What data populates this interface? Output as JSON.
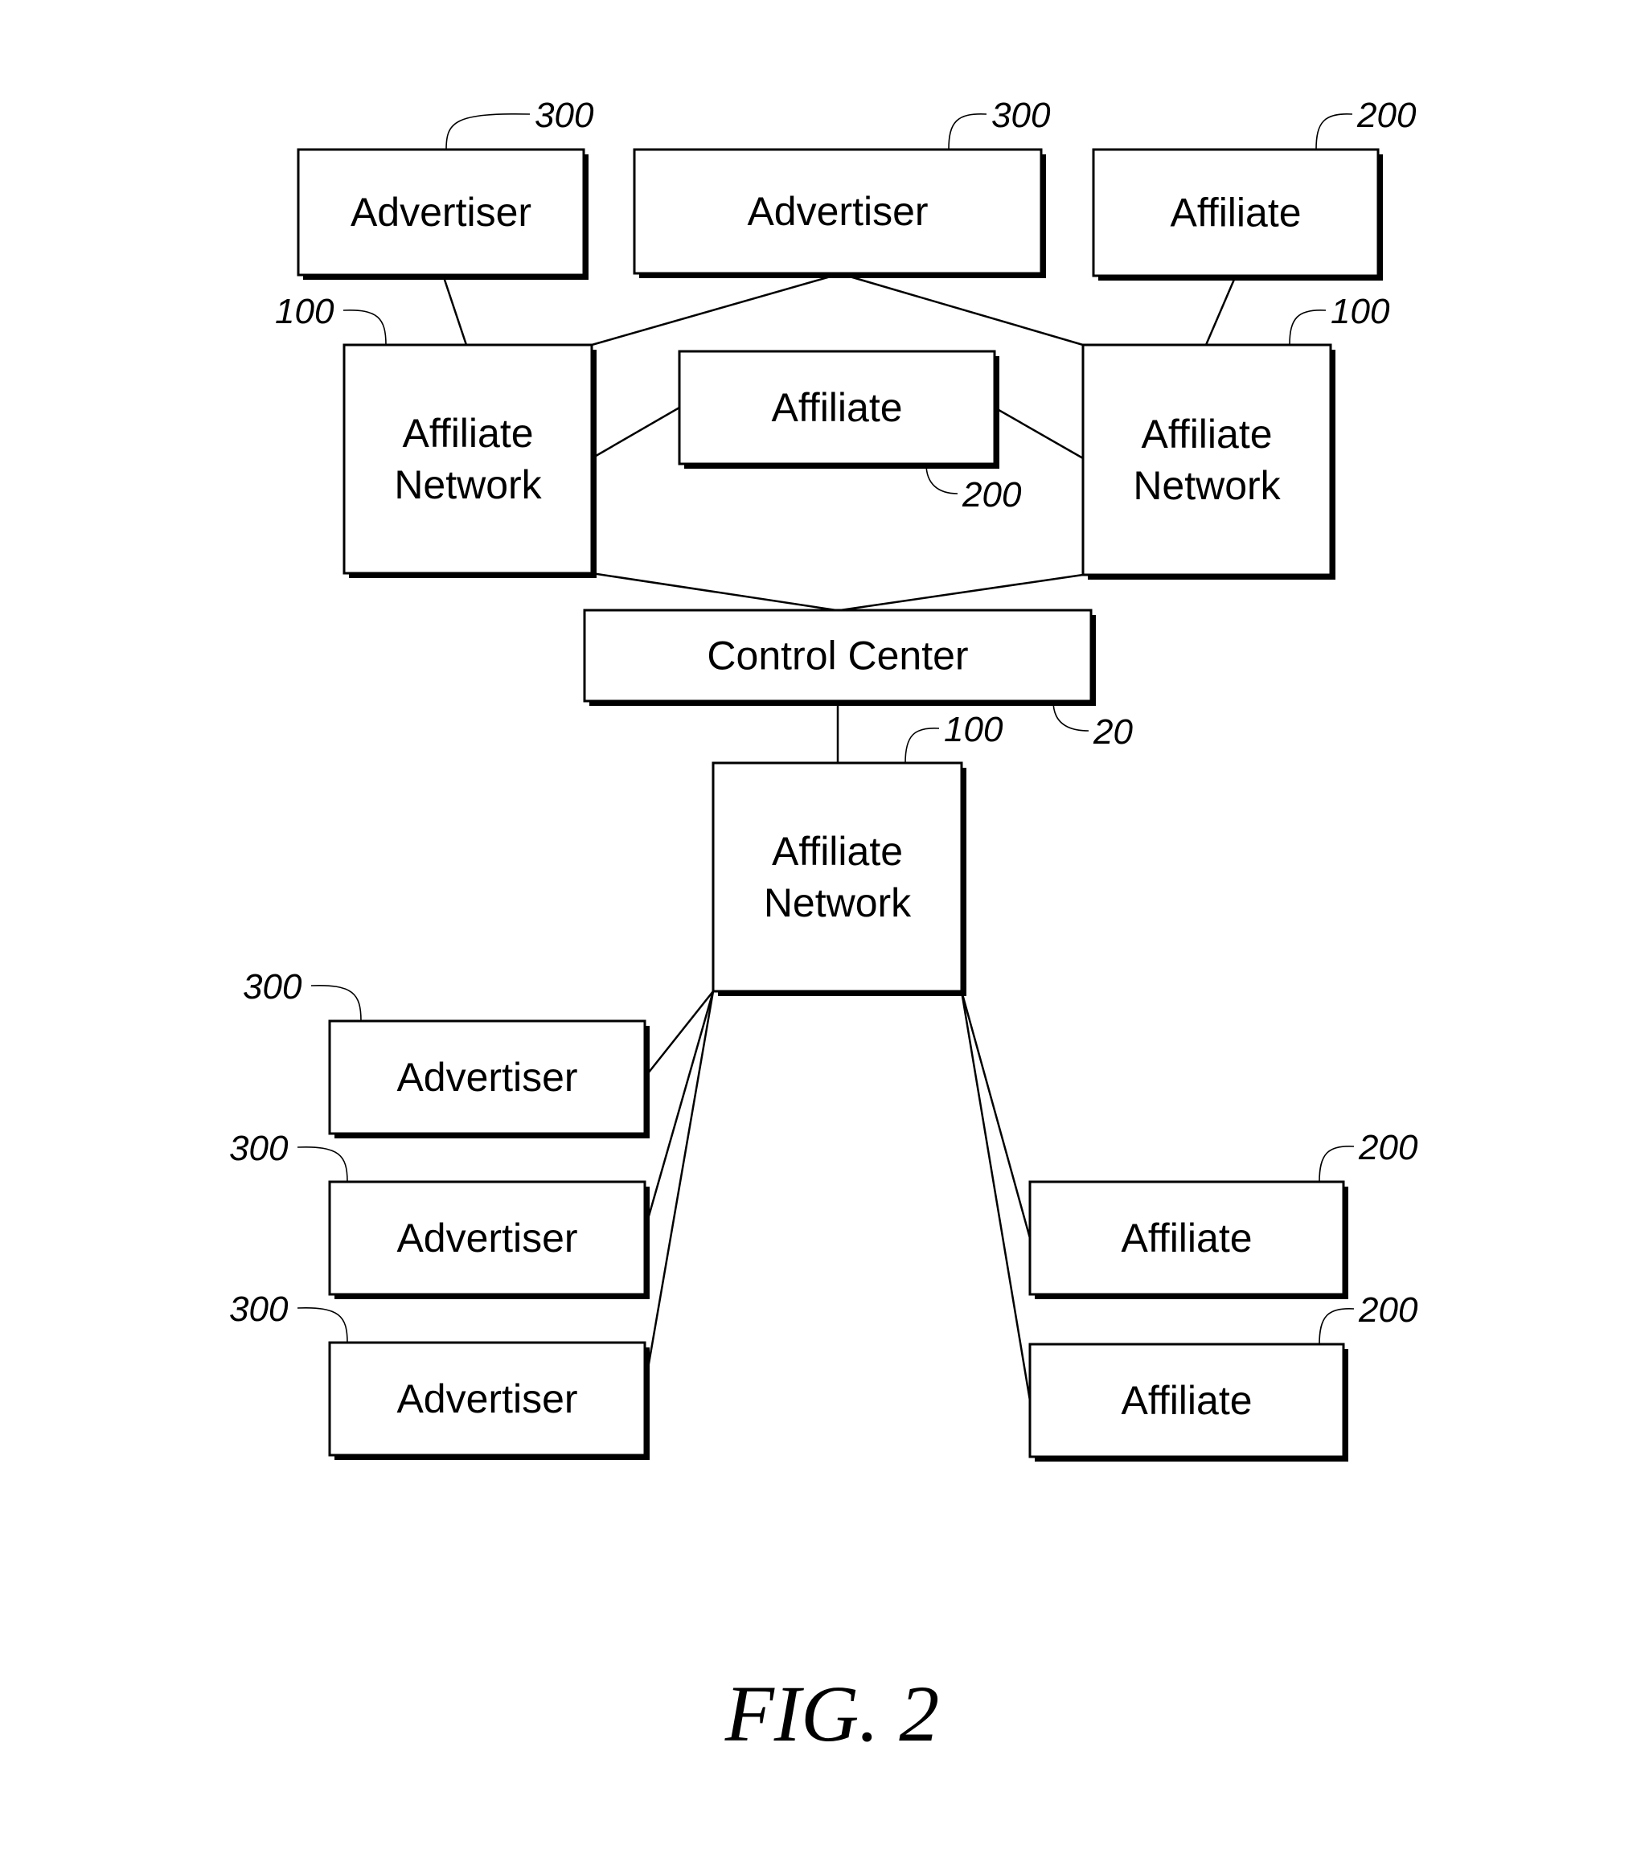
{
  "figure": {
    "caption": "FIG. 2"
  },
  "nodes": [
    {
      "id": "adv-top-left",
      "label": [
        "Advertiser"
      ],
      "ref": "300"
    },
    {
      "id": "adv-top-mid",
      "label": [
        "Advertiser"
      ],
      "ref": "300"
    },
    {
      "id": "aff-top-right",
      "label": [
        "Affiliate"
      ],
      "ref": "200"
    },
    {
      "id": "an-left",
      "label": [
        "Affiliate",
        "Network"
      ],
      "ref": "100"
    },
    {
      "id": "aff-mid",
      "label": [
        "Affiliate"
      ],
      "ref": "200"
    },
    {
      "id": "an-right",
      "label": [
        "Affiliate",
        "Network"
      ],
      "ref": "100"
    },
    {
      "id": "control-center",
      "label": [
        "Control Center"
      ],
      "ref": "20"
    },
    {
      "id": "an-bottom",
      "label": [
        "Affiliate",
        "Network"
      ],
      "ref": "100"
    },
    {
      "id": "adv-bottom-1",
      "label": [
        "Advertiser"
      ],
      "ref": "300"
    },
    {
      "id": "adv-bottom-2",
      "label": [
        "Advertiser"
      ],
      "ref": "300"
    },
    {
      "id": "adv-bottom-3",
      "label": [
        "Advertiser"
      ],
      "ref": "300"
    },
    {
      "id": "aff-bottom-1",
      "label": [
        "Affiliate"
      ],
      "ref": "200"
    },
    {
      "id": "aff-bottom-2",
      "label": [
        "Affiliate"
      ],
      "ref": "200"
    }
  ],
  "edges": [
    [
      "adv-top-left",
      "an-left"
    ],
    [
      "adv-top-mid",
      "an-left"
    ],
    [
      "adv-top-mid",
      "an-right"
    ],
    [
      "aff-top-right",
      "an-right"
    ],
    [
      "an-left",
      "aff-mid"
    ],
    [
      "aff-mid",
      "an-right"
    ],
    [
      "an-left",
      "control-center"
    ],
    [
      "an-right",
      "control-center"
    ],
    [
      "control-center",
      "an-bottom"
    ],
    [
      "an-bottom",
      "adv-bottom-1"
    ],
    [
      "an-bottom",
      "adv-bottom-2"
    ],
    [
      "an-bottom",
      "adv-bottom-3"
    ],
    [
      "an-bottom",
      "aff-bottom-1"
    ],
    [
      "an-bottom",
      "aff-bottom-2"
    ]
  ]
}
